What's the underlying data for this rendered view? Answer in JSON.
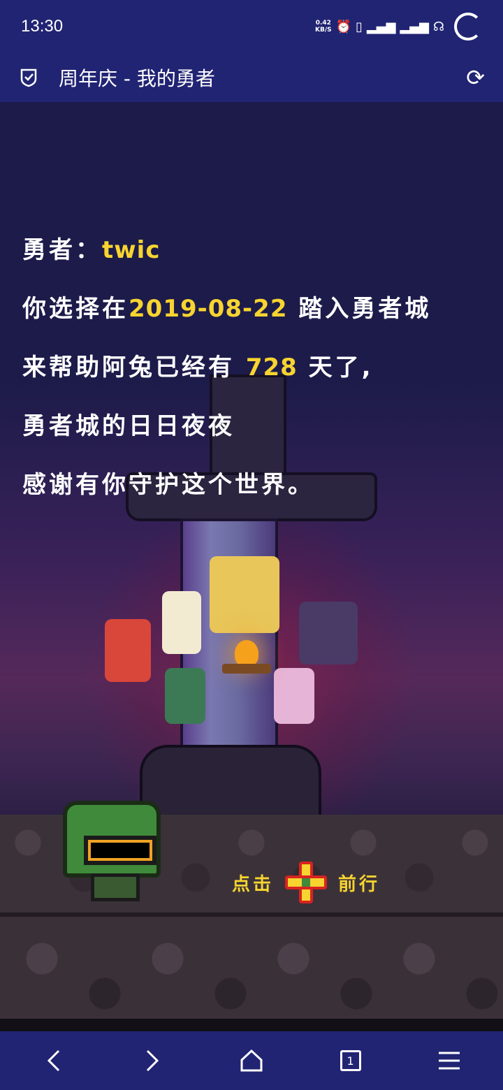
{
  "status_bar": {
    "time": "13:30",
    "net_speed_value": "0.42",
    "net_speed_unit": "KB/S",
    "icons": [
      "alarm-icon",
      "vibrate-icon",
      "signal-4g-icon",
      "signal-4g-icon",
      "hd-icon",
      "loading-spinner-icon"
    ]
  },
  "app_bar": {
    "title": "周年庆 - 我的勇者",
    "left_icon": "shield-check-icon",
    "right_icon": "refresh-icon"
  },
  "story": {
    "line1_prefix": "勇者：",
    "hero_name": "twic",
    "line2_prefix": "你选择在",
    "join_date": "2019-08-22",
    "line2_suffix": " 踏入勇者城",
    "line3_prefix": "来帮助阿兔已经有 ",
    "days": "728",
    "line3_suffix": " 天了,",
    "line4": "勇者城的日日夜夜",
    "line5": "感谢有你守护这个世界。"
  },
  "tap_hint": {
    "left_text": "点击",
    "right_text": "前行",
    "icon": "dpad-icon"
  },
  "nav_bar": {
    "back_icon": "back-arrow-icon",
    "forward_icon": "forward-arrow-icon",
    "home_icon": "home-icon",
    "tabs_count": "1",
    "menu_icon": "menu-icon"
  },
  "colors": {
    "bar_bg": "#212473",
    "scene_bg": "#1c1b4a",
    "highlight": "#f7d430"
  }
}
